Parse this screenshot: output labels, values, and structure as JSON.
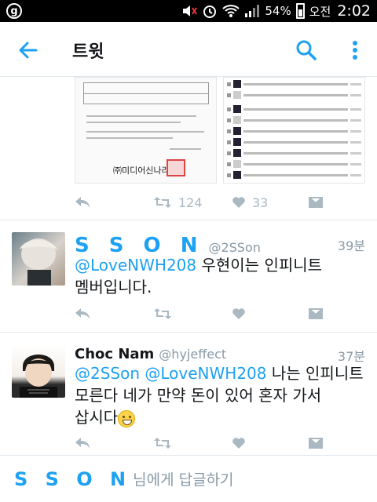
{
  "status_bar": {
    "battery": "54%",
    "ampm": "오전",
    "time": "2:02"
  },
  "app_bar": {
    "title": "트윗"
  },
  "first_tweet": {
    "doc_org": "㈜미디어신나라",
    "retweets": "124",
    "likes": "33"
  },
  "tweets": [
    {
      "name": "S S O N",
      "handle": "@2SSon",
      "time": "39분",
      "mention": "@LoveNWH208",
      "text_line1": " 우현이는 인피니트",
      "text_line2": "멤버입니다."
    },
    {
      "name": "Choc Nam",
      "handle": "@hyjeffect",
      "time": "37분",
      "mention1": "@2SSon",
      "mention2": "@LoveNWH208",
      "text_line1": " 나는 인피니트",
      "text_line2": "모른다 네가 만약 돈이 있어 혼자 가서",
      "text_line3": "삽시다"
    }
  ],
  "reply": {
    "target": "S S O N",
    "suffix": "님에게 답글하기"
  },
  "colors": {
    "accent": "#1da1f2",
    "muted": "#aab8c2",
    "divider": "#e1e8ed"
  }
}
